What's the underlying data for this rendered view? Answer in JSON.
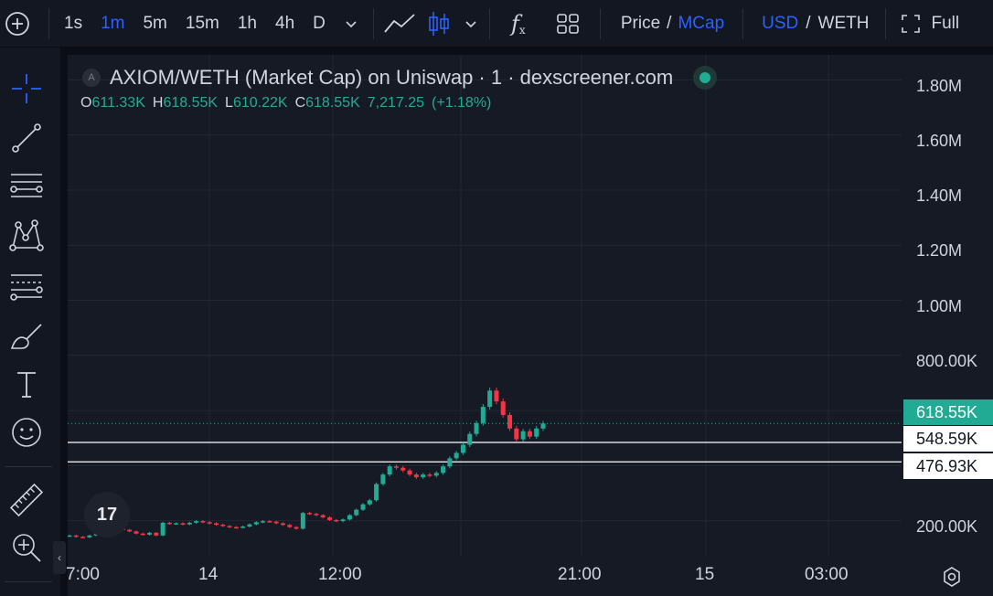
{
  "toolbar": {
    "add_label": "⊕",
    "intervals": [
      "1s",
      "1m",
      "5m",
      "15m",
      "1h",
      "4h",
      "D"
    ],
    "active_interval": "1m",
    "fx_label": "f",
    "fx_sub": "x",
    "price_label": "Price",
    "mcap_label": "MCap",
    "slash1": "/",
    "usd_label": "USD",
    "slash2": "/",
    "weth_label": "WETH",
    "full_label": "Full"
  },
  "legend": {
    "avatar_letter": "A",
    "title": "AXIOM/WETH (Market Cap) on Uniswap · 1 · dexscreener.com",
    "o_key": "O",
    "o_val": "611.33K",
    "h_key": "H",
    "h_val": "618.55K",
    "l_key": "L",
    "l_val": "610.22K",
    "c_key": "C",
    "c_val": "618.55K",
    "volume": "7,217.25",
    "change": "(+1.18%)"
  },
  "price_axis": {
    "ticks": [
      "1.80M",
      "1.60M",
      "1.40M",
      "1.20M",
      "1.00M",
      "800.00K",
      "200.00K"
    ],
    "current_label": "618.55K",
    "line1_label": "548.59K",
    "line2_label": "476.93K"
  },
  "time_axis": {
    "ticks": [
      "7:00",
      "14",
      "12:00",
      "21:00",
      "15",
      "03:00"
    ]
  },
  "logo_text": "17",
  "colors": {
    "up": "#22ab94",
    "down": "#f23645",
    "accent": "#2962ff",
    "background": "#161a25"
  },
  "chart_data": {
    "type": "candlestick",
    "series": [
      {
        "name": "AXIOM/WETH (Market Cap)",
        "values": [
          {
            "c": 205000,
            "d": 1
          },
          {
            "c": 200000,
            "d": -1
          },
          {
            "c": 198000,
            "d": -1
          },
          {
            "c": 205000,
            "d": 1
          },
          {
            "c": 210000,
            "d": 1
          },
          {
            "c": 215000,
            "d": 1
          },
          {
            "c": 222000,
            "d": 1
          },
          {
            "c": 230000,
            "d": 1
          },
          {
            "c": 226000,
            "d": -1
          },
          {
            "c": 220000,
            "d": -1
          },
          {
            "c": 212000,
            "d": -1
          },
          {
            "c": 208000,
            "d": -1
          },
          {
            "c": 215000,
            "d": 1
          },
          {
            "c": 205000,
            "d": -1
          },
          {
            "c": 252000,
            "d": 1
          },
          {
            "c": 248000,
            "d": -1
          },
          {
            "c": 250000,
            "d": 1
          },
          {
            "c": 246000,
            "d": -1
          },
          {
            "c": 252000,
            "d": 1
          },
          {
            "c": 258000,
            "d": 1
          },
          {
            "c": 254000,
            "d": -1
          },
          {
            "c": 250000,
            "d": -1
          },
          {
            "c": 245000,
            "d": -1
          },
          {
            "c": 240000,
            "d": -1
          },
          {
            "c": 236000,
            "d": -1
          },
          {
            "c": 234000,
            "d": -1
          },
          {
            "c": 238000,
            "d": 1
          },
          {
            "c": 246000,
            "d": 1
          },
          {
            "c": 254000,
            "d": 1
          },
          {
            "c": 258000,
            "d": 1
          },
          {
            "c": 256000,
            "d": -1
          },
          {
            "c": 250000,
            "d": -1
          },
          {
            "c": 244000,
            "d": -1
          },
          {
            "c": 236000,
            "d": -1
          },
          {
            "c": 230000,
            "d": -1
          },
          {
            "c": 288000,
            "d": 1
          },
          {
            "c": 285000,
            "d": -1
          },
          {
            "c": 280000,
            "d": -1
          },
          {
            "c": 272000,
            "d": -1
          },
          {
            "c": 262000,
            "d": -1
          },
          {
            "c": 258000,
            "d": -1
          },
          {
            "c": 264000,
            "d": 1
          },
          {
            "c": 280000,
            "d": 1
          },
          {
            "c": 300000,
            "d": 1
          },
          {
            "c": 320000,
            "d": 1
          },
          {
            "c": 335000,
            "d": 1
          },
          {
            "c": 395000,
            "d": 1
          },
          {
            "c": 430000,
            "d": 1
          },
          {
            "c": 460000,
            "d": 1
          },
          {
            "c": 455000,
            "d": -1
          },
          {
            "c": 445000,
            "d": -1
          },
          {
            "c": 430000,
            "d": -1
          },
          {
            "c": 420000,
            "d": -1
          },
          {
            "c": 430000,
            "d": 1
          },
          {
            "c": 426000,
            "d": -1
          },
          {
            "c": 436000,
            "d": 1
          },
          {
            "c": 460000,
            "d": 1
          },
          {
            "c": 490000,
            "d": 1
          },
          {
            "c": 510000,
            "d": 1
          },
          {
            "c": 540000,
            "d": 1
          },
          {
            "c": 580000,
            "d": 1
          },
          {
            "c": 620000,
            "d": 1
          },
          {
            "c": 680000,
            "d": 1
          },
          {
            "c": 740000,
            "d": 1
          },
          {
            "c": 700000,
            "d": -1
          },
          {
            "c": 650000,
            "d": -1
          },
          {
            "c": 600000,
            "d": -1
          },
          {
            "c": 560000,
            "d": -1
          },
          {
            "c": 590000,
            "d": 1
          },
          {
            "c": 570000,
            "d": -1
          },
          {
            "c": 600000,
            "d": 1
          },
          {
            "c": 618550,
            "d": 1
          }
        ]
      }
    ],
    "current_value": 618550,
    "horizontal_lines": [
      548590,
      476930
    ],
    "ylim": [
      130000,
      1980000
    ],
    "ylabel": "",
    "xlabel": ""
  }
}
